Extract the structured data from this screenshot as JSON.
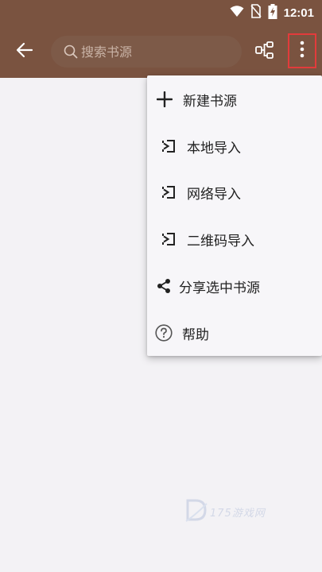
{
  "status_bar": {
    "time": "12:01",
    "icons": [
      "wifi-icon",
      "no-sim-icon",
      "battery-charging-icon"
    ]
  },
  "toolbar": {
    "back_icon": "arrow-left-icon",
    "search": {
      "placeholder": "搜索书源",
      "value": ""
    },
    "group_icon": "group-icon",
    "more_icon": "more-vertical-icon",
    "highlight_color": "#e23b3b",
    "background": "#7a5340"
  },
  "menu": {
    "items": [
      {
        "label": "新建书源",
        "icon": "plus-icon"
      },
      {
        "label": "本地导入",
        "icon": "import-icon"
      },
      {
        "label": "网络导入",
        "icon": "import-icon"
      },
      {
        "label": "二维码导入",
        "icon": "import-icon"
      },
      {
        "label": "分享选中书源",
        "icon": "share-icon"
      },
      {
        "label": "帮助",
        "icon": "help-icon"
      }
    ]
  },
  "watermark": {
    "text": "175游戏网"
  }
}
